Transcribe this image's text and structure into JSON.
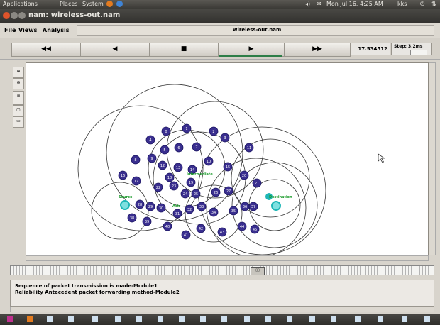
{
  "top_panel": {
    "applications": "Applications",
    "places": "Places",
    "system": "System",
    "clock": "Mon Jul 16,  4:25 AM",
    "user": "kks"
  },
  "window": {
    "title": "nam: wireless-out.nam"
  },
  "menubar": {
    "file": "File",
    "views": "Views",
    "analysis": "Analysis",
    "file_name": "wireless-out.nam"
  },
  "transport": {
    "rewind_fast": "◀◀",
    "rewind": "◀",
    "stop": "■",
    "play": "▶",
    "forward_fast": "▶▶",
    "time": "17.534512",
    "step_label": "Step: 3.2ms"
  },
  "tools": [
    "zoom-in-icon",
    "zoom-out-icon",
    "edit-icon",
    "cursor-icon",
    "monitor-icon"
  ],
  "canvas": {
    "labels": {
      "source": "Source",
      "intermediate": "Intermediate",
      "destination": "Destination",
      "ackd": "Ack"
    },
    "nodes": [
      "0",
      "1",
      "2",
      "3",
      "4",
      "5",
      "6",
      "7",
      "8",
      "9",
      "10",
      "11",
      "12",
      "13",
      "14",
      "15",
      "16",
      "17",
      "18",
      "19",
      "20",
      "21",
      "22",
      "23",
      "24",
      "25",
      "26",
      "27",
      "28",
      "29",
      "30",
      "31",
      "32",
      "33",
      "34",
      "35",
      "36",
      "37",
      "38",
      "39",
      "40",
      "41",
      "42",
      "43",
      "44",
      "45"
    ]
  },
  "annotations": [
    "Sequence of packet transmission is made-Module1",
    "Reliability Antecedent packet forwarding method-Module2"
  ],
  "colors": {
    "node_fill": "#3a2f8f",
    "node_ring": "#ffffff",
    "special_node": "#1fb6b6",
    "label_green": "#1a9a2a"
  }
}
